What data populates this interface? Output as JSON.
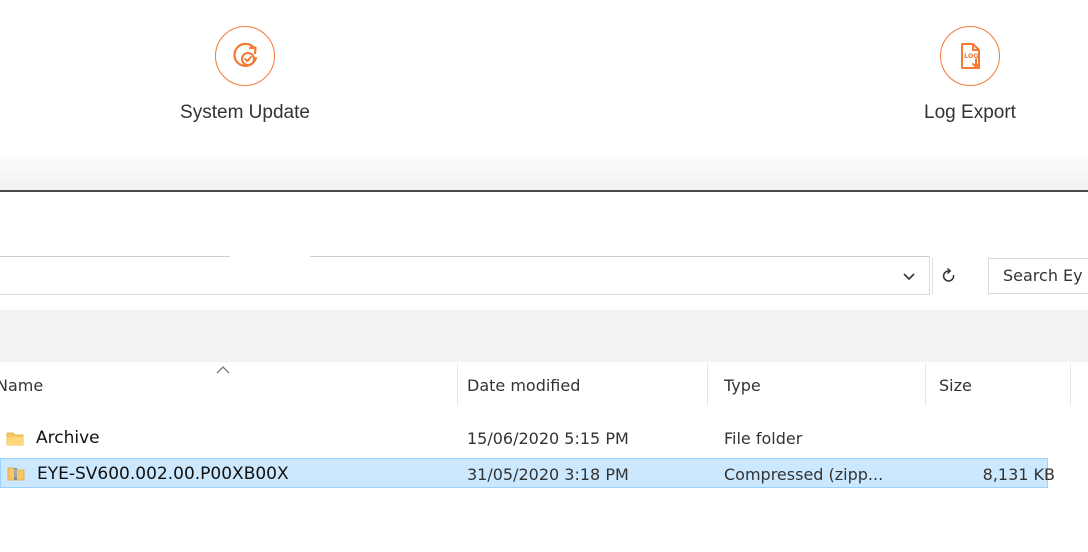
{
  "app": {
    "tiles": [
      {
        "label": "System Update",
        "icon": "system-update-icon"
      },
      {
        "label": "Log Export",
        "icon": "log-export-icon",
        "icon_text": "LOG"
      }
    ],
    "accent": "#f27a36"
  },
  "explorer": {
    "address": {
      "dropdown_icon": "chevron-down-icon",
      "refresh_icon": "refresh-icon"
    },
    "search": {
      "placeholder": "Search Ey"
    },
    "columns": {
      "name": "Name",
      "date_modified": "Date modified",
      "type": "Type",
      "size": "Size"
    },
    "files": [
      {
        "name": "Archive",
        "date_modified": "15/06/2020 5:15 PM",
        "type": "File folder",
        "size": "",
        "icon": "folder-icon",
        "selected": false
      },
      {
        "name": "EYE-SV600.002.00.P00XB00X",
        "date_modified": "31/05/2020 3:18 PM",
        "type": "Compressed (zipp...",
        "size": "8,131 KB",
        "icon": "zip-folder-icon",
        "selected": true
      }
    ],
    "selection_color": "#cce8ff"
  }
}
